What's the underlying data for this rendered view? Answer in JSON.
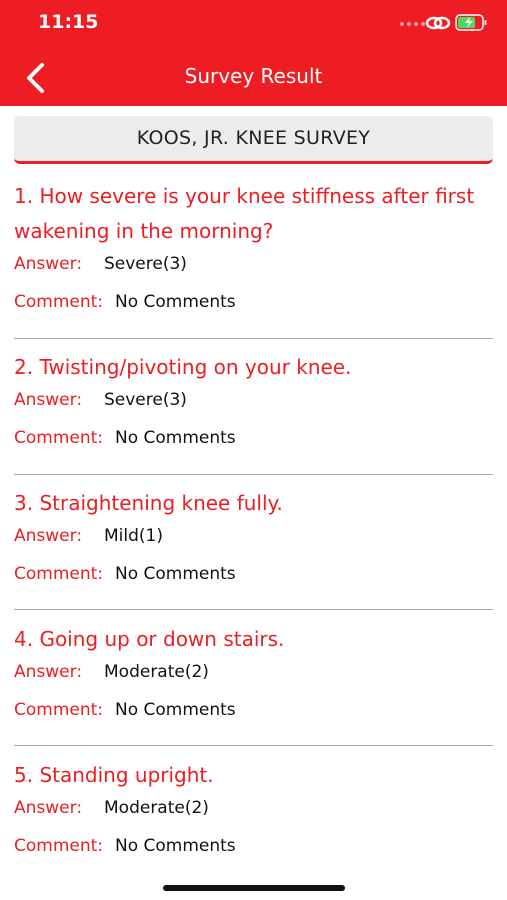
{
  "status_bar": {
    "time": "11:15"
  },
  "nav": {
    "title": "Survey Result"
  },
  "survey": {
    "title": "KOOS, JR. KNEE SURVEY"
  },
  "labels": {
    "answer": "Answer:",
    "comment": "Comment:"
  },
  "questions": [
    {
      "question": "1. How severe is your knee stiffness after first wakening in the morning?",
      "answer": "Severe(3)",
      "comment": "No Comments"
    },
    {
      "question": "2. Twisting/pivoting on your knee.",
      "answer": "Severe(3)",
      "comment": "No Comments"
    },
    {
      "question": "3. Straightening knee fully.",
      "answer": "Mild(1)",
      "comment": "No Comments"
    },
    {
      "question": "4. Going up or down stairs.",
      "answer": "Moderate(2)",
      "comment": "No Comments"
    },
    {
      "question": "5. Standing upright.",
      "answer": "Moderate(2)",
      "comment": "No Comments"
    }
  ],
  "colors": {
    "accent": "#ee1d23",
    "header_bg": "#ececee",
    "divider": "#a8a8a8"
  }
}
